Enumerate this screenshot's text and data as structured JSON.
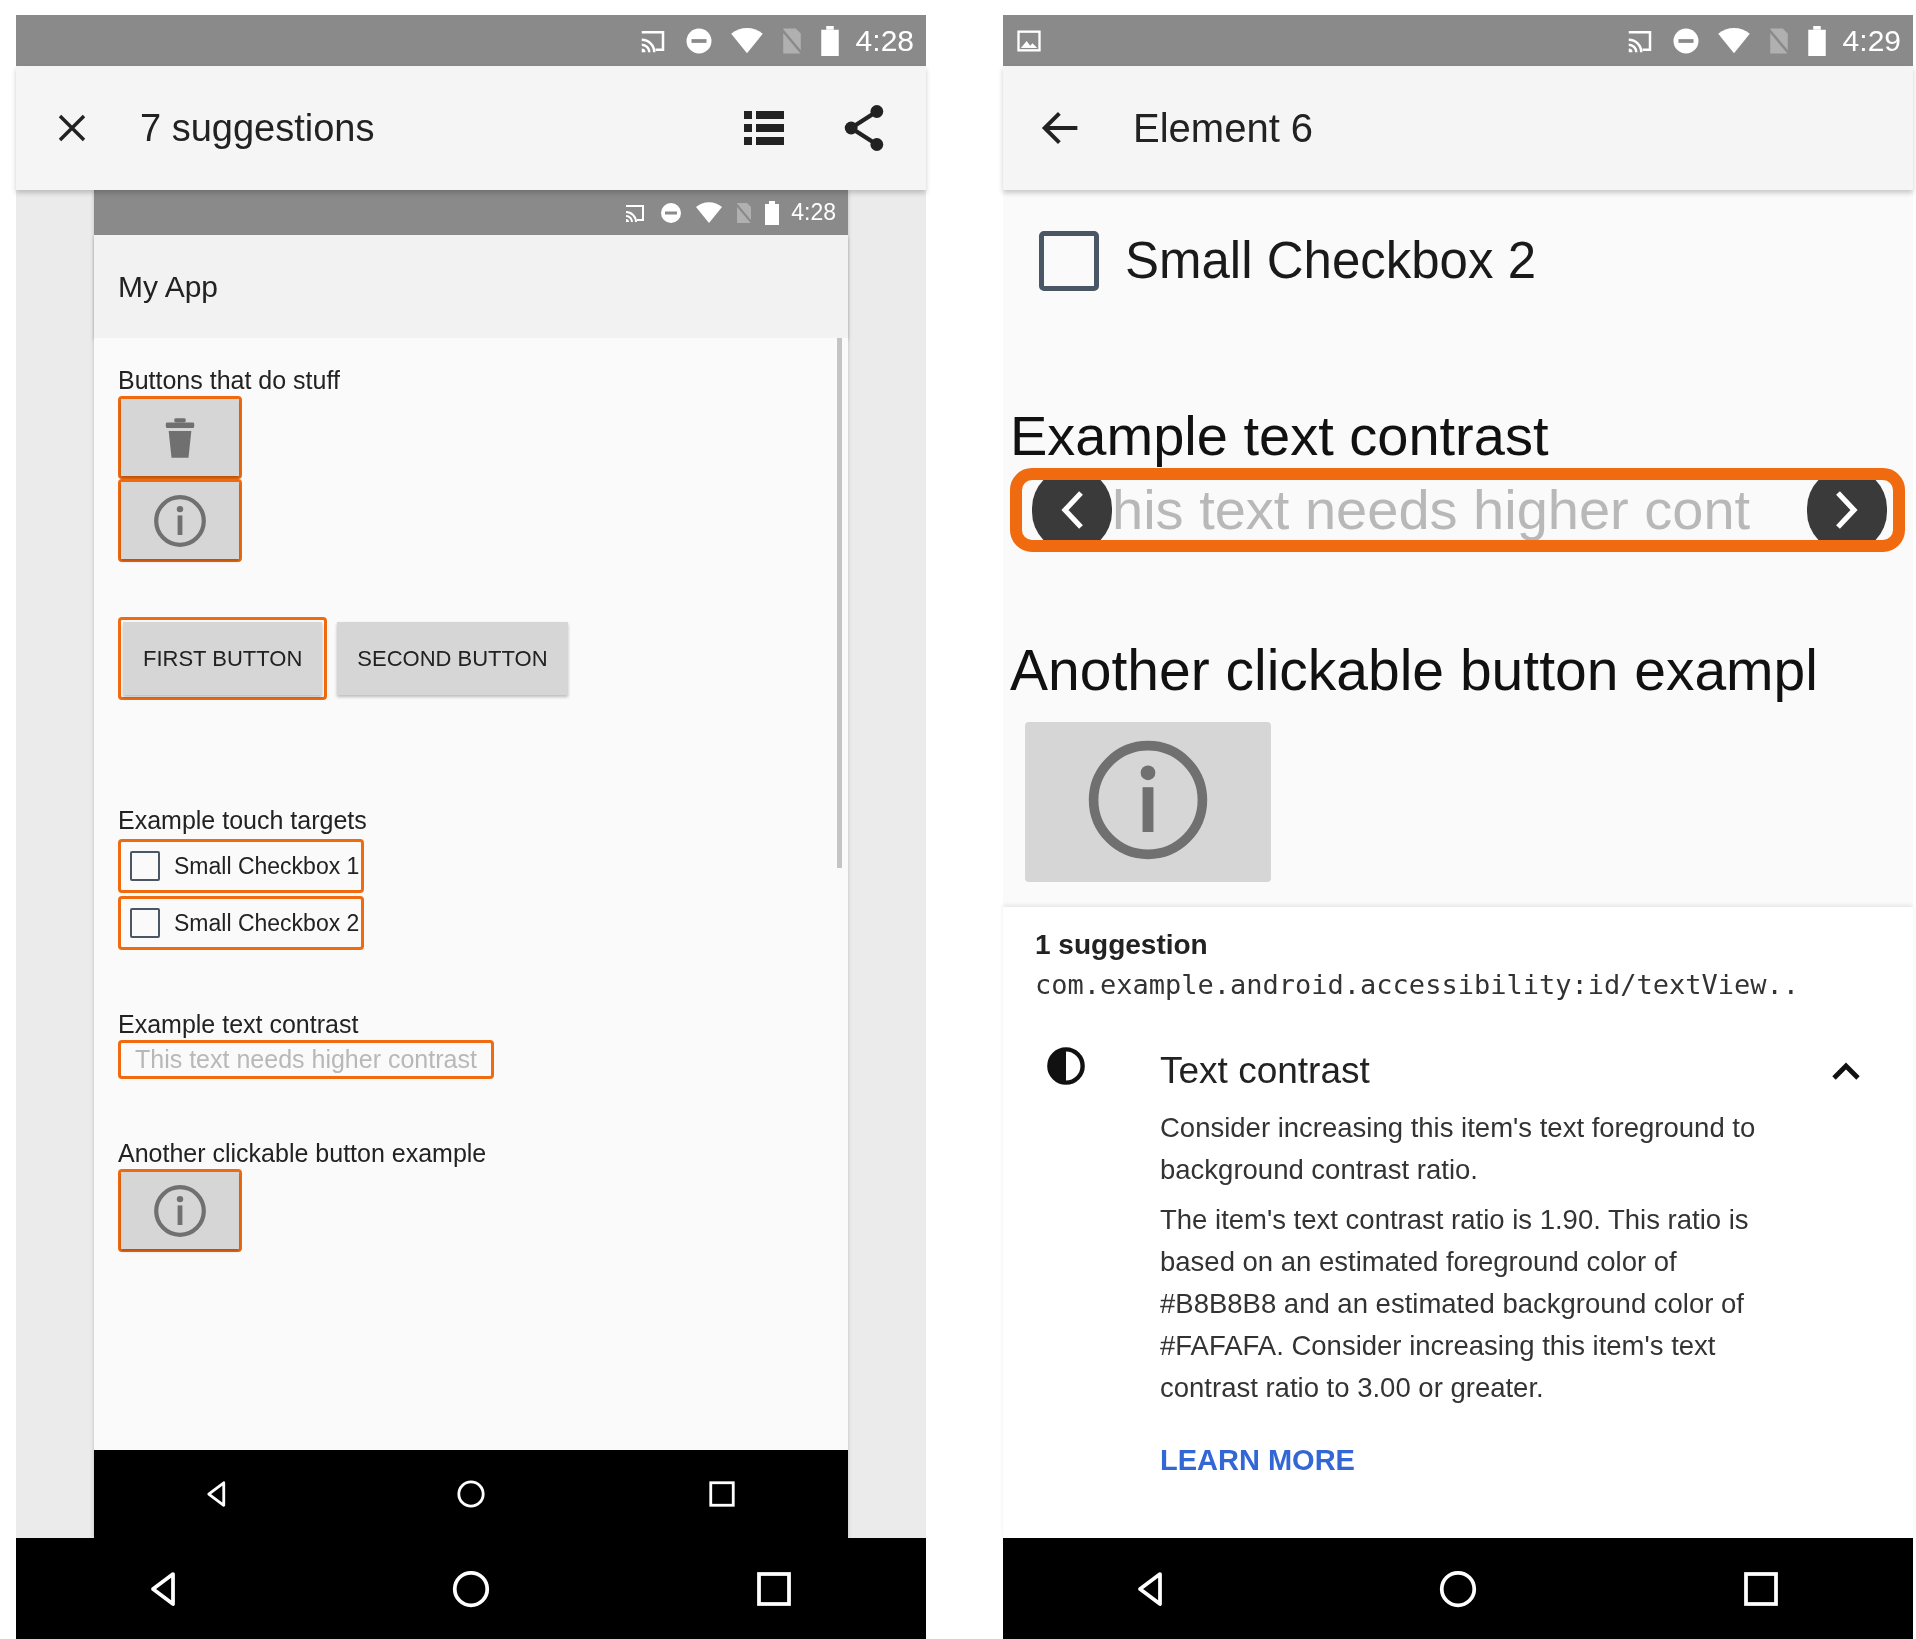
{
  "left_screen": {
    "status_bar": {
      "time": "4:28"
    },
    "app_bar": {
      "title": "7 suggestions"
    },
    "preview": {
      "status_bar": {
        "time": "4:28"
      },
      "app_bar": {
        "title": "My App"
      },
      "content": [
        {
          "kind": "heading",
          "text": "Buttons that do stuff"
        },
        {
          "kind": "delete_button",
          "flagged": true
        },
        {
          "kind": "info_button",
          "flagged": true
        },
        {
          "kind": "button_row",
          "buttons": [
            {
              "label": "FIRST BUTTON",
              "flagged": true
            },
            {
              "label": "SECOND BUTTON",
              "flagged": false
            }
          ]
        },
        {
          "kind": "heading",
          "text": "Example touch targets"
        },
        {
          "kind": "checkbox",
          "label": "Small Checkbox 1",
          "checked": false,
          "flagged": true
        },
        {
          "kind": "checkbox",
          "label": "Small Checkbox 2",
          "checked": false,
          "flagged": true
        },
        {
          "kind": "heading",
          "text": "Example text contrast"
        },
        {
          "kind": "low_contrast_text",
          "text": "This text needs higher contrast",
          "flagged": true
        },
        {
          "kind": "heading",
          "text": "Another clickable button example"
        },
        {
          "kind": "info_button",
          "flagged": true
        }
      ]
    }
  },
  "right_screen": {
    "status_bar": {
      "time": "4:29"
    },
    "app_bar": {
      "title": "Element 6"
    },
    "zoomed": {
      "checkbox": {
        "label": "Small Checkbox 2",
        "checked": false
      },
      "heading": "Example text contrast",
      "low_contrast_text": "his text needs higher cont",
      "heading_2": "Another clickable button exampl"
    },
    "sheet": {
      "count": "1 suggestion",
      "element_id": "com.example.android.accessibility:id/textView..",
      "suggestions": [
        {
          "title": "Text contrast",
          "expanded": true,
          "paragraphs": [
            "Consider increasing this item's text foreground to background contrast ratio.",
            "The item's text contrast ratio is 1.90. This ratio is based on an estimated foreground color of #B8B8B8 and an estimated background color of #FAFAFA. Consider increasing this item's text contrast ratio to 3.00 or greater."
          ],
          "link": "LEARN MORE"
        }
      ]
    }
  }
}
